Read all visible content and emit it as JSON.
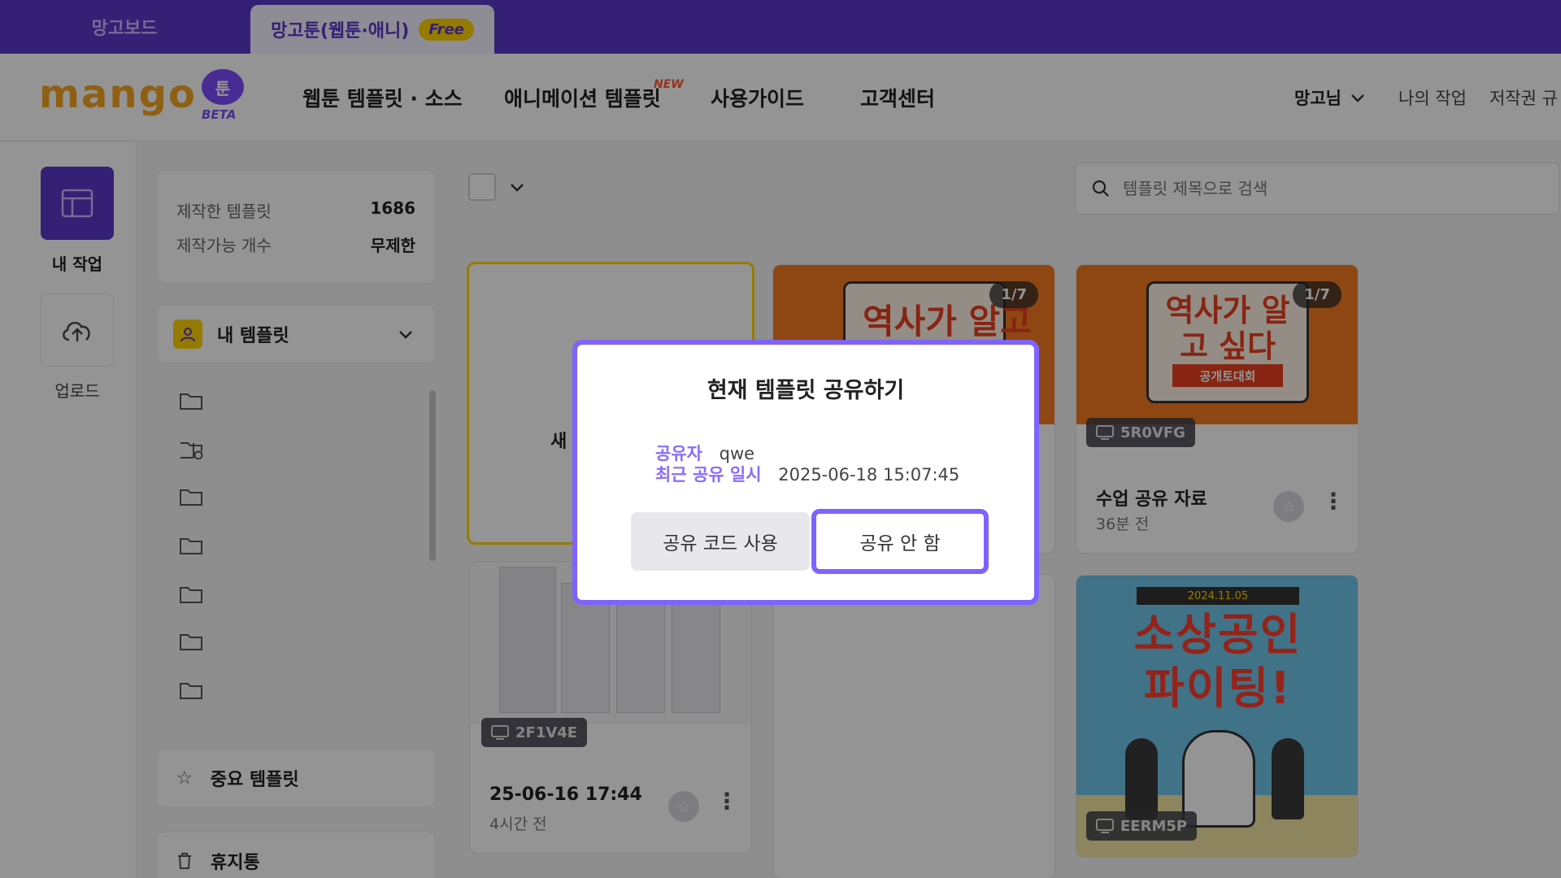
{
  "tabs": {
    "board_label": "망고보드",
    "active_label": "망고툰(웹툰·애니)",
    "free_badge": "Free"
  },
  "header": {
    "logo_text": "mango",
    "logo_bubble": "툰",
    "logo_beta": "BETA",
    "nav": {
      "webtoon": "웹툰 템플릿 · 소스",
      "animation": "애니메이션 템플릿",
      "animation_new": "NEW",
      "guide": "사용가이드",
      "support": "고객센터"
    },
    "user_menu": "망고님",
    "my_work": "나의 작업",
    "copyright": "저작권 규"
  },
  "rail": {
    "my_work_label": "내 작업",
    "upload_label": "업로드"
  },
  "sidebar": {
    "stats": [
      {
        "label": "제작한 템플릿",
        "value": "1686"
      },
      {
        "label": "제작가능 개수",
        "value": "무제한"
      }
    ],
    "my_templates": "내 템플릿",
    "important": "중요 템플릿",
    "trash": "휴지통"
  },
  "content": {
    "search_placeholder": "템플릿 제목으로 검색",
    "new_card_partial": "새",
    "templates": [
      {
        "page": "1/7",
        "thumb_text": "역사가 알고 싶다",
        "code": "",
        "title": "",
        "time": ""
      },
      {
        "page": "1/7",
        "thumb_text": "역사가 알고 싶다",
        "thumb_sub": "공개토대회",
        "code": "5R0VFG",
        "title": "수업 공유 자료",
        "time": "36분 전"
      },
      {
        "code": "2F1V4E",
        "title": "25-06-16 17:44",
        "time": "4시간 전"
      },
      {
        "thumb_text": "소상공인 파이팅!",
        "thumb_date": "2024.11.05",
        "code": "EERM5P"
      }
    ]
  },
  "modal": {
    "title": "현재 템플릿 공유하기",
    "sharer_label": "공유자",
    "sharer_value": "qwe",
    "recent_label": "최근 공유 일시",
    "recent_value": "2025-06-18 15:07:45",
    "btn_use_code": "공유 코드 사용",
    "btn_no_share": "공유 안 함"
  },
  "colors": {
    "brand_purple": "#5a37c8",
    "accent_violet": "#7e63ff",
    "logo_orange": "#f5a623",
    "badge_yellow": "#ffd400"
  }
}
